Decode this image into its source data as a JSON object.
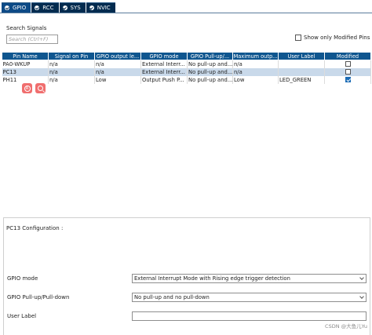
{
  "tabs": [
    {
      "label": "GPIO",
      "icon": "check-circle-icon",
      "active": true
    },
    {
      "label": "RCC",
      "icon": "check-circle-icon",
      "active": false
    },
    {
      "label": "SYS",
      "icon": "check-circle-icon",
      "active": false
    },
    {
      "label": "NVIC",
      "icon": "check-circle-icon",
      "active": false
    }
  ],
  "search": {
    "label": "Search Signals",
    "placeholder": "Search (Ctrl+F)",
    "show_only_modified_label": "Show only Modified Pins",
    "show_only_modified_checked": false
  },
  "table": {
    "headers": [
      "Pin Name",
      "Signal on Pin",
      "GPIO output le...",
      "GPIO mode",
      "GPIO Pull-up/...",
      "Maximum outp...",
      "User Label",
      "Modified"
    ],
    "rows": [
      {
        "cells": [
          "PA0-WKUP",
          "n/a",
          "n/a",
          "External Interr...",
          "No pull-up and...",
          "n/a",
          ""
        ],
        "modified": false,
        "selected": false
      },
      {
        "cells": [
          "PC13",
          "n/a",
          "n/a",
          "External Interr...",
          "No pull-up and...",
          "n/a",
          ""
        ],
        "modified": false,
        "selected": true
      },
      {
        "cells": [
          "PH11",
          "n/a",
          "Low",
          "Output Push P...",
          "No pull-up and...",
          "Low",
          "LED_GREEN"
        ],
        "modified": true,
        "selected": false
      }
    ]
  },
  "floating_toolbar": {
    "icons": [
      "translate-icon",
      "search-icon"
    ],
    "translate_glyph": "A"
  },
  "config": {
    "title": "PC13 Configuration :",
    "gpio_mode_label": "GPIO mode",
    "gpio_mode_value": "External Interrupt Mode with Rising edge trigger detection",
    "pull_label": "GPIO Pull-up/Pull-down",
    "pull_value": "No pull-up and no pull-down",
    "user_label_label": "User Label",
    "user_label_value": ""
  },
  "watermark": "CSDN @大鱼儿Yu",
  "colors": {
    "tab_bg": "#032b4f",
    "tab_active_bg": "#0d4a86",
    "header_bg": "#0f568f",
    "selected_row_bg": "#c9d9ea",
    "checkbox_checked": "#1a6bb5",
    "floating_icon_bg": "#f06e6e"
  }
}
